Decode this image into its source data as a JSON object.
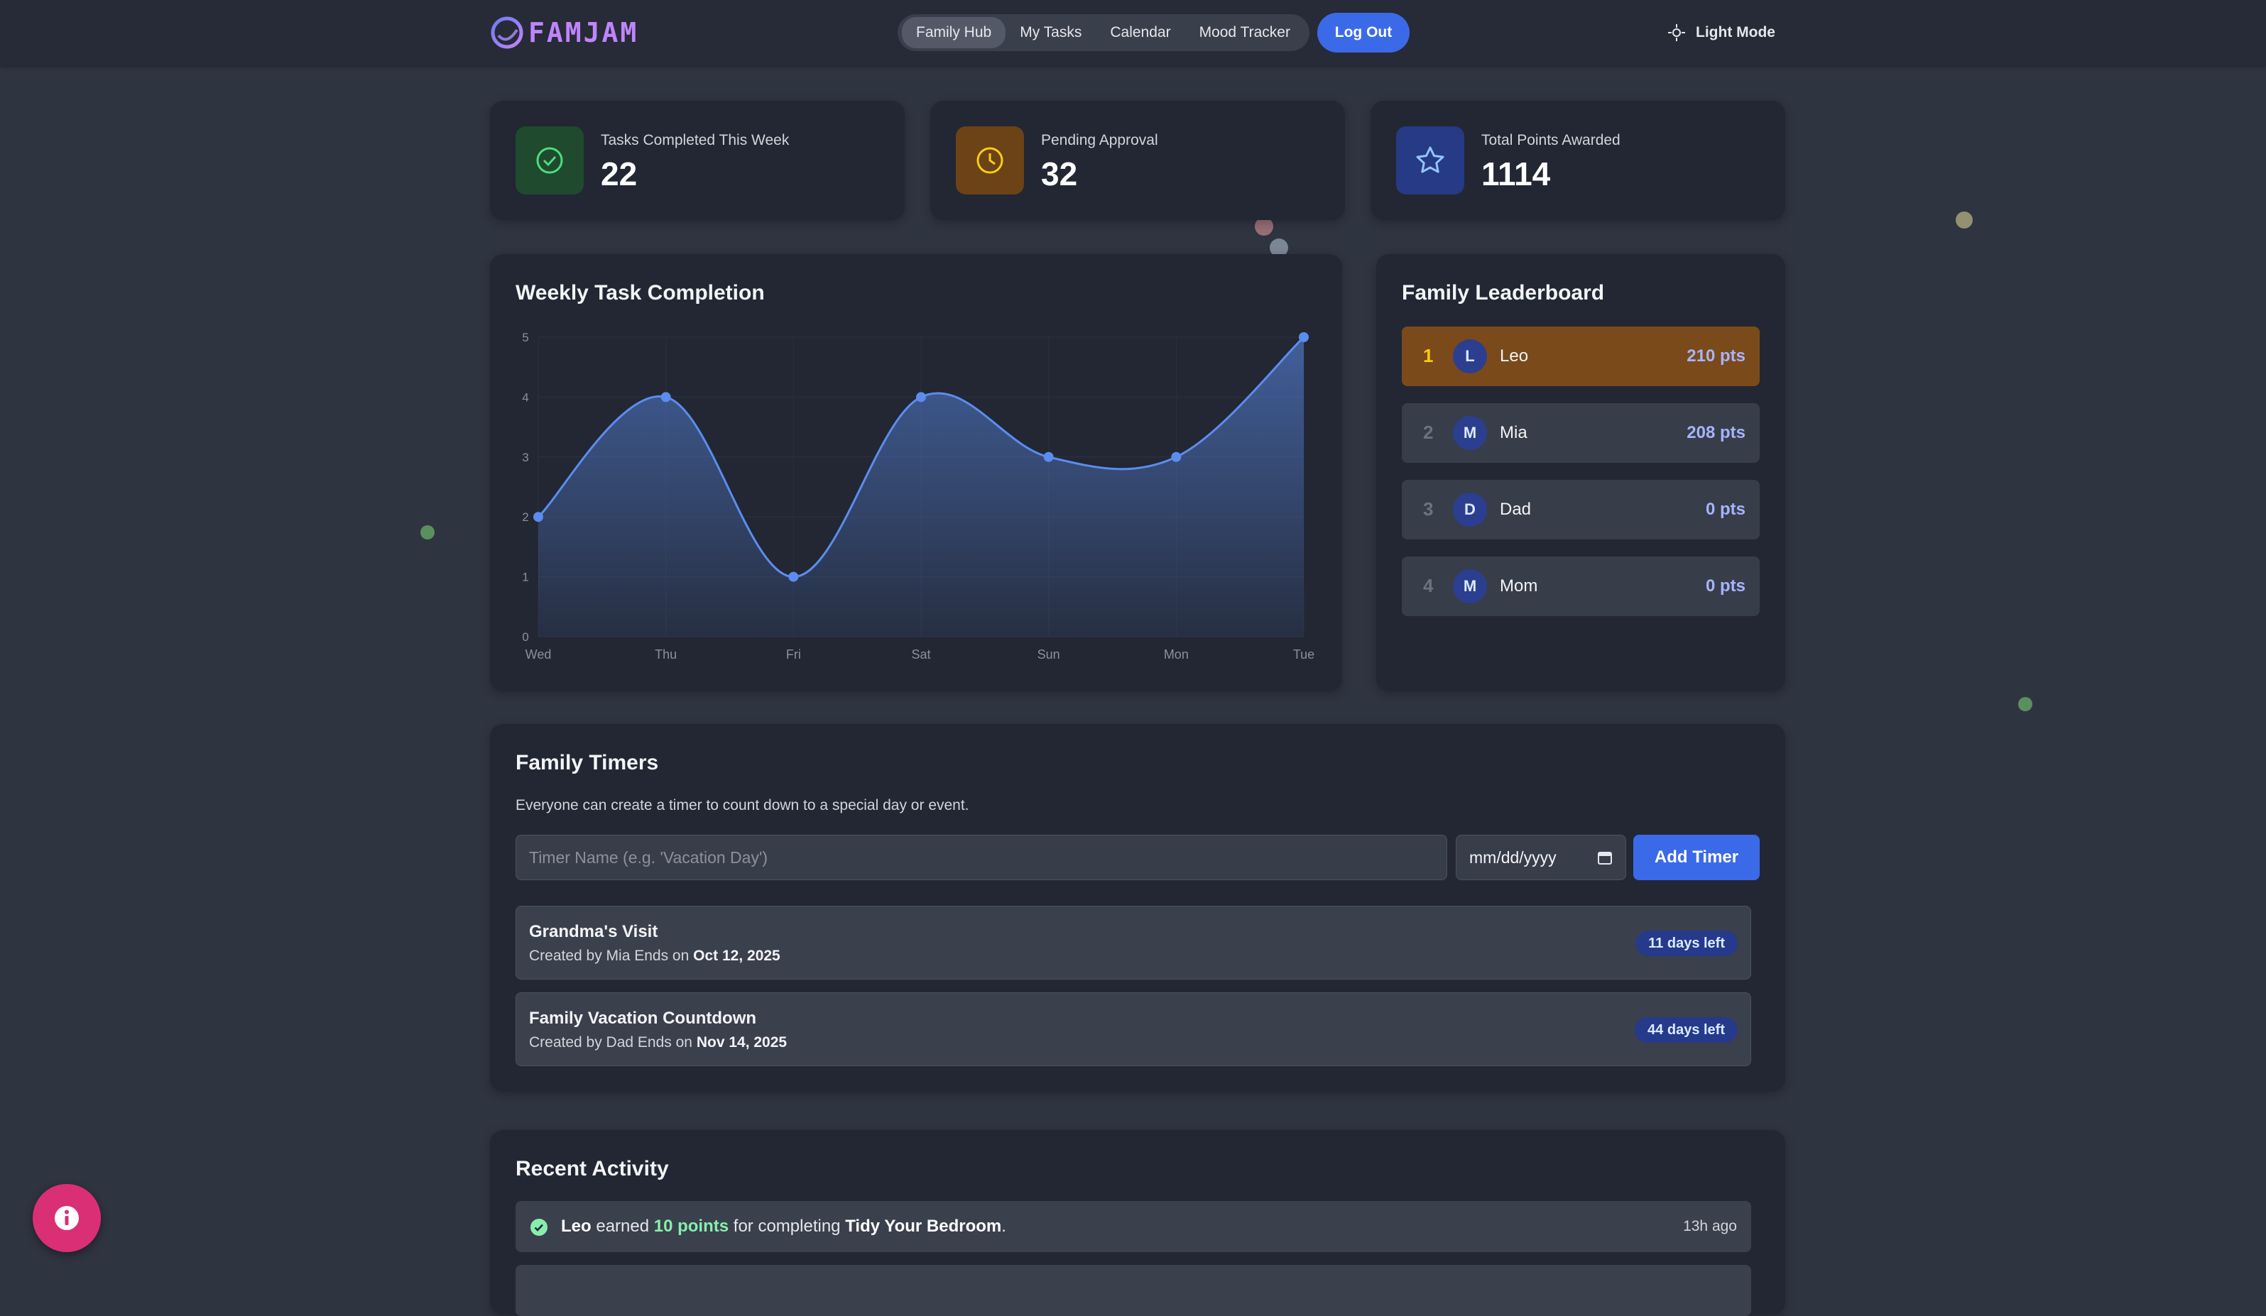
{
  "header": {
    "logo_text": "FAMJAM",
    "nav": [
      "Family Hub",
      "My Tasks",
      "Calendar",
      "Mood Tracker"
    ],
    "logout_label": "Log Out",
    "theme_label": "Light Mode"
  },
  "stats": [
    {
      "label": "Tasks Completed This Week",
      "value": "22",
      "color": "#22c55e"
    },
    {
      "label": "Pending Approval",
      "value": "32",
      "color": "#facc15"
    },
    {
      "label": "Total Points Awarded",
      "value": "1114",
      "color": "#93c5fd"
    }
  ],
  "chart": {
    "title": "Weekly Task Completion"
  },
  "chart_data": {
    "type": "area",
    "title": "Weekly Task Completion",
    "categories": [
      "Wed",
      "Thu",
      "Fri",
      "Sat",
      "Sun",
      "Mon",
      "Tue"
    ],
    "values": [
      2,
      4,
      1,
      4,
      3,
      3,
      5
    ],
    "ylim": [
      0,
      5
    ],
    "yticks": [
      0,
      1,
      2,
      3,
      4,
      5
    ],
    "grid": true,
    "color": "#5b8def"
  },
  "leaderboard": {
    "title": "Family Leaderboard",
    "entries": [
      {
        "rank": "1",
        "initial": "L",
        "name": "Leo",
        "points": "210 pts"
      },
      {
        "rank": "2",
        "initial": "M",
        "name": "Mia",
        "points": "208 pts"
      },
      {
        "rank": "3",
        "initial": "D",
        "name": "Dad",
        "points": "0 pts"
      },
      {
        "rank": "4",
        "initial": "M",
        "name": "Mom",
        "points": "0 pts"
      }
    ]
  },
  "timers": {
    "title": "Family Timers",
    "description": "Everyone can create a timer to count down to a special day or event.",
    "name_placeholder": "Timer Name (e.g. 'Vacation Day')",
    "date_placeholder": "mm/dd/yyyy",
    "add_label": "Add Timer",
    "items": [
      {
        "name": "Grandma's Visit",
        "created_prefix": "Created by Mia Ends on",
        "date": "Oct 12, 2025",
        "badge": "11 days left"
      },
      {
        "name": "Family Vacation Countdown",
        "created_prefix": "Created by Dad Ends on",
        "date": "Nov 14, 2025",
        "badge": "44 days left"
      }
    ]
  },
  "activity": {
    "title": "Recent Activity",
    "items": [
      {
        "user": "Leo",
        "verb": "earned",
        "points": "10 points",
        "middle": "for completing",
        "task": "Tidy Your Bedroom",
        "end": ".",
        "time": "13h ago"
      }
    ]
  }
}
